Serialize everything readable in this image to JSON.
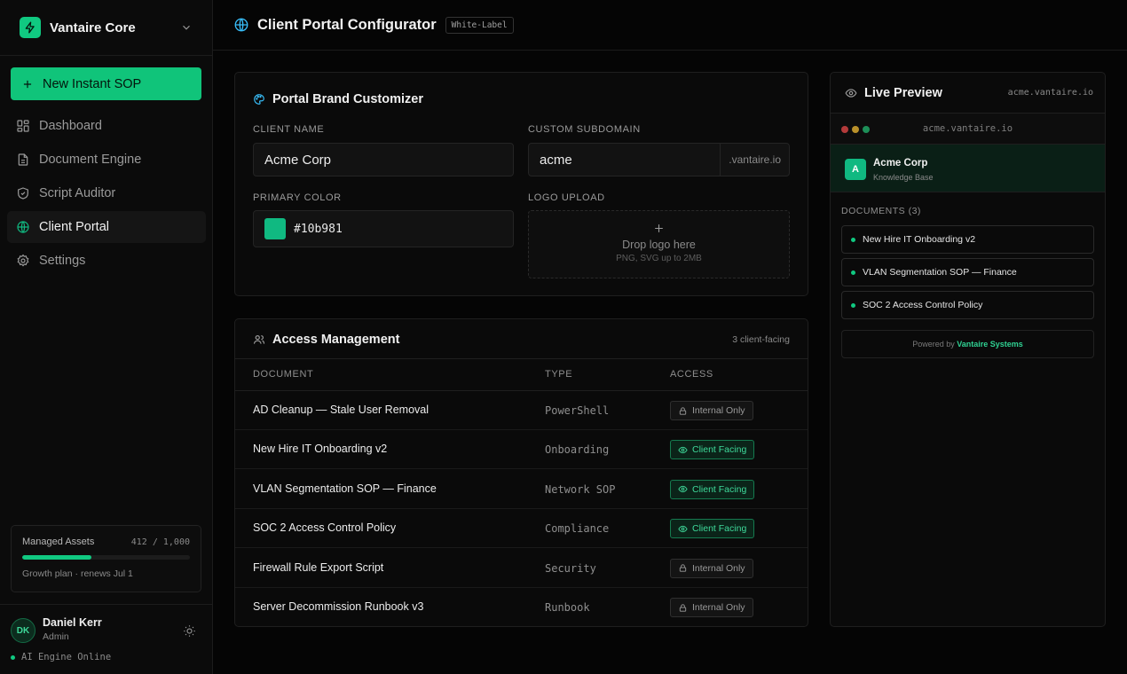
{
  "workspace": {
    "name": "Vantaire Core"
  },
  "sidebar": {
    "new_button": "New Instant SOP",
    "items": [
      {
        "label": "Dashboard",
        "icon": "grid-icon",
        "active": false
      },
      {
        "label": "Document Engine",
        "icon": "document-icon",
        "active": false
      },
      {
        "label": "Script Auditor",
        "icon": "shield-icon",
        "active": false
      },
      {
        "label": "Client Portal",
        "icon": "globe-icon",
        "active": true
      },
      {
        "label": "Settings",
        "icon": "gear-icon",
        "active": false
      }
    ],
    "assets": {
      "label": "Managed Assets",
      "count": "412 / 1,000",
      "used": 412,
      "total": 1000,
      "plan": "Growth plan · renews Jul 1"
    },
    "user": {
      "initials": "DK",
      "name": "Daniel Kerr",
      "role": "Admin"
    },
    "engine_status": "AI Engine Online"
  },
  "header": {
    "title": "Client Portal Configurator",
    "tag": "White-Label"
  },
  "brand": {
    "title": "Portal Brand Customizer",
    "client_name_label": "CLIENT NAME",
    "client_name_value": "Acme Corp",
    "subdomain_label": "CUSTOM SUBDOMAIN",
    "subdomain_value": "acme",
    "subdomain_suffix": ".vantaire.io",
    "color_label": "PRIMARY COLOR",
    "color_value": "#10b981",
    "logo_label": "LOGO UPLOAD",
    "logo_title": "Drop logo here",
    "logo_hint": "PNG, SVG up to 2MB"
  },
  "access": {
    "title": "Access Management",
    "summary": "3 client-facing",
    "columns": {
      "document": "DOCUMENT",
      "type": "TYPE",
      "access": "ACCESS"
    },
    "rows": [
      {
        "document": "AD Cleanup — Stale User Removal",
        "type": "PowerShell",
        "access": "Internal Only",
        "client": false
      },
      {
        "document": "New Hire IT Onboarding v2",
        "type": "Onboarding",
        "access": "Client Facing",
        "client": true
      },
      {
        "document": "VLAN Segmentation SOP — Finance",
        "type": "Network SOP",
        "access": "Client Facing",
        "client": true
      },
      {
        "document": "SOC 2 Access Control Policy",
        "type": "Compliance",
        "access": "Client Facing",
        "client": true
      },
      {
        "document": "Firewall Rule Export Script",
        "type": "Security",
        "access": "Internal Only",
        "client": false
      },
      {
        "document": "Server Decommission Runbook v3",
        "type": "Runbook",
        "access": "Internal Only",
        "client": false
      }
    ]
  },
  "preview": {
    "title": "Live Preview",
    "domain": "acme.vantaire.io",
    "url": "acme.vantaire.io",
    "logo_letter": "A",
    "client_name": "Acme Corp",
    "subtitle": "Knowledge Base",
    "docs_title": "DOCUMENTS (3)",
    "docs": [
      "New Hire IT Onboarding v2",
      "VLAN Segmentation SOP — Finance",
      "SOC 2 Access Control Policy"
    ],
    "powered_by": "Powered by",
    "powered_brand": "Vantaire Systems"
  },
  "colors": {
    "accent": "#10b981",
    "accent_button": "#10c47a",
    "background": "#050505"
  }
}
